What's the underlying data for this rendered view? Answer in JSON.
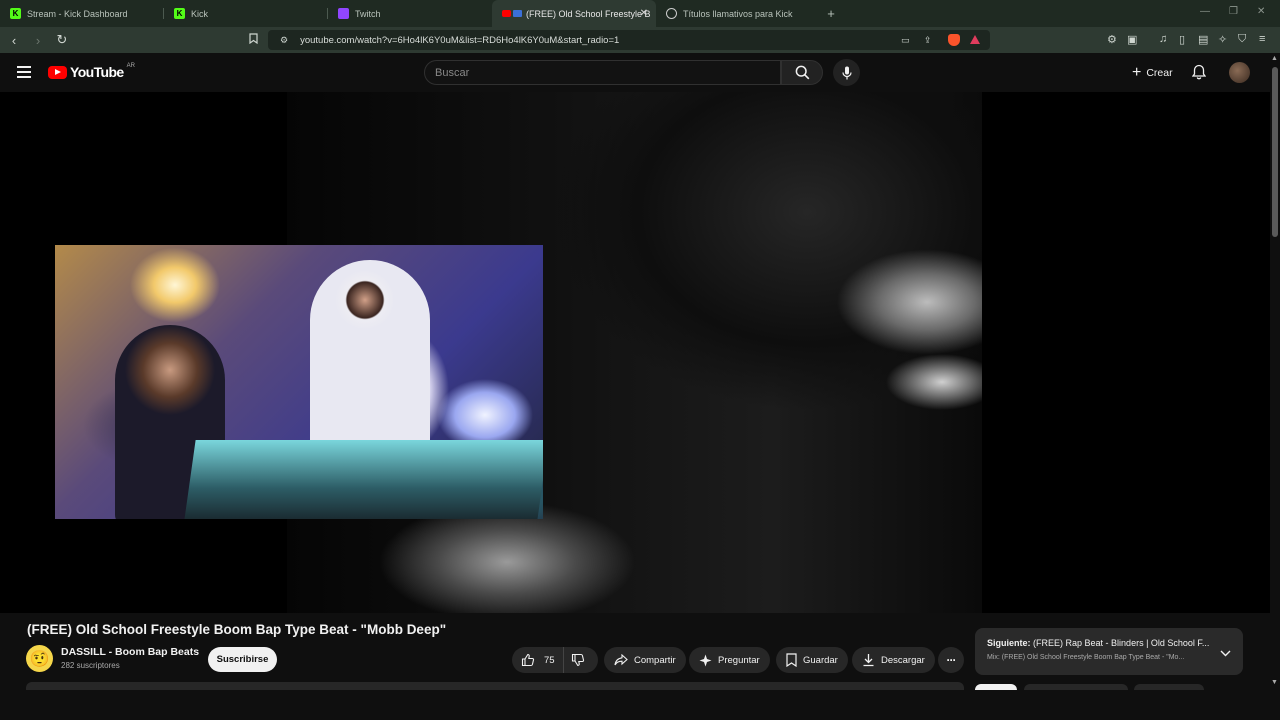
{
  "browser": {
    "tabs": [
      {
        "title": "Stream - Kick Dashboard",
        "icon": "kick-icon"
      },
      {
        "title": "Kick",
        "icon": "kick-icon"
      },
      {
        "title": "Twitch",
        "icon": "twitch-icon"
      },
      {
        "title": "(FREE) Old School Freestyle B",
        "icon": "youtube-icon",
        "active": true
      },
      {
        "title": "Títulos llamativos para Kick",
        "icon": "chatgpt-icon"
      }
    ],
    "url": "youtube.com/watch?v=6Ho4lK6Y0uM&list=RD6Ho4lK6Y0uM&start_radio=1"
  },
  "youtube": {
    "logo_text": "YouTube",
    "country_code": "AR",
    "search_placeholder": "Buscar",
    "create_label": "Crear"
  },
  "video": {
    "title": "(FREE) Old School Freestyle Boom Bap Type Beat - \"Mobb Deep\"",
    "channel_name": "DASSILL - Boom Bap Beats",
    "subscribers": "282 suscriptores",
    "subscribe_label": "Suscribirse",
    "likes": "75",
    "share_label": "Compartir",
    "ask_label": "Preguntar",
    "save_label": "Guardar",
    "download_label": "Descargar"
  },
  "up_next": {
    "label": "Siguiente:",
    "title": "(FREE) Rap Beat - Blinders | Old School F...",
    "playlist": "Mix: (FREE) Old School Freestyle Boom Bap Type Beat - \"Mo..."
  },
  "colors": {
    "accent_red": "#ff0000",
    "browser_bg": "#2e3a32",
    "page_bg": "#0f0f0f"
  }
}
